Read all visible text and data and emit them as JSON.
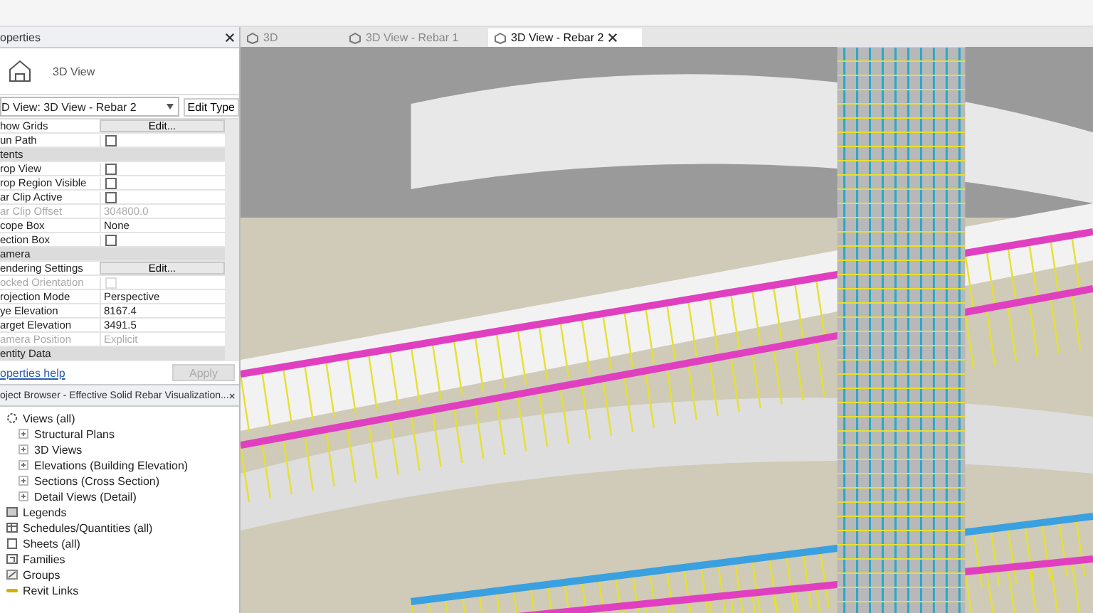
{
  "properties": {
    "title": "operties",
    "type_name": "3D View",
    "view_selector": "D View: 3D View - Rebar 2",
    "edit_type": "Edit Type",
    "rows": [
      {
        "kind": "button",
        "label": "how Grids",
        "value": "Edit...",
        "disabled": false
      },
      {
        "kind": "checkbox",
        "label": "un Path",
        "checked": false,
        "disabled": false
      },
      {
        "kind": "section",
        "label": "tents"
      },
      {
        "kind": "checkbox",
        "label": "rop View",
        "checked": false,
        "disabled": false
      },
      {
        "kind": "checkbox",
        "label": "rop Region Visible",
        "checked": false,
        "disabled": false
      },
      {
        "kind": "checkbox",
        "label": "ar Clip Active",
        "checked": false,
        "disabled": false
      },
      {
        "kind": "text",
        "label": "ar Clip Offset",
        "value": "304800.0",
        "disabled": true
      },
      {
        "kind": "text",
        "label": "cope Box",
        "value": "None",
        "disabled": false
      },
      {
        "kind": "checkbox",
        "label": "ection Box",
        "checked": false,
        "disabled": false
      },
      {
        "kind": "section",
        "label": "amera"
      },
      {
        "kind": "button",
        "label": "endering Settings",
        "value": "Edit...",
        "disabled": false
      },
      {
        "kind": "checkbox",
        "label": "ocked Orientation",
        "checked": false,
        "disabled": true
      },
      {
        "kind": "text",
        "label": "rojection Mode",
        "value": "Perspective",
        "disabled": false
      },
      {
        "kind": "text",
        "label": "ye Elevation",
        "value": "8167.4",
        "disabled": false
      },
      {
        "kind": "text",
        "label": "arget Elevation",
        "value": "3491.5",
        "disabled": false
      },
      {
        "kind": "text",
        "label": "amera Position",
        "value": "Explicit",
        "disabled": true
      },
      {
        "kind": "section",
        "label": "entity Data"
      }
    ],
    "help": "operties help",
    "apply": "Apply"
  },
  "project_browser": {
    "title": "oject Browser - Effective Solid Rebar Visualization...",
    "items": [
      {
        "label": "Views (all)",
        "kind": "views",
        "expanded": true,
        "children": [
          {
            "label": "Structural Plans",
            "expanded": false
          },
          {
            "label": "3D Views",
            "expanded": false
          },
          {
            "label": "Elevations (Building Elevation)",
            "expanded": false
          },
          {
            "label": "Sections (Cross Section)",
            "expanded": false
          },
          {
            "label": "Detail Views (Detail)",
            "expanded": false
          }
        ]
      },
      {
        "label": "Legends",
        "kind": "legend"
      },
      {
        "label": "Schedules/Quantities (all)",
        "kind": "schedule"
      },
      {
        "label": "Sheets (all)",
        "kind": "sheet"
      },
      {
        "label": "Families",
        "kind": "family"
      },
      {
        "label": "Groups",
        "kind": "group"
      },
      {
        "label": "Revit Links",
        "kind": "link"
      }
    ]
  },
  "tabs": [
    {
      "label": "3D",
      "selected": false
    },
    {
      "label": "3D View - Rebar 1",
      "selected": false
    },
    {
      "label": "3D View - Rebar 2",
      "selected": true
    }
  ]
}
